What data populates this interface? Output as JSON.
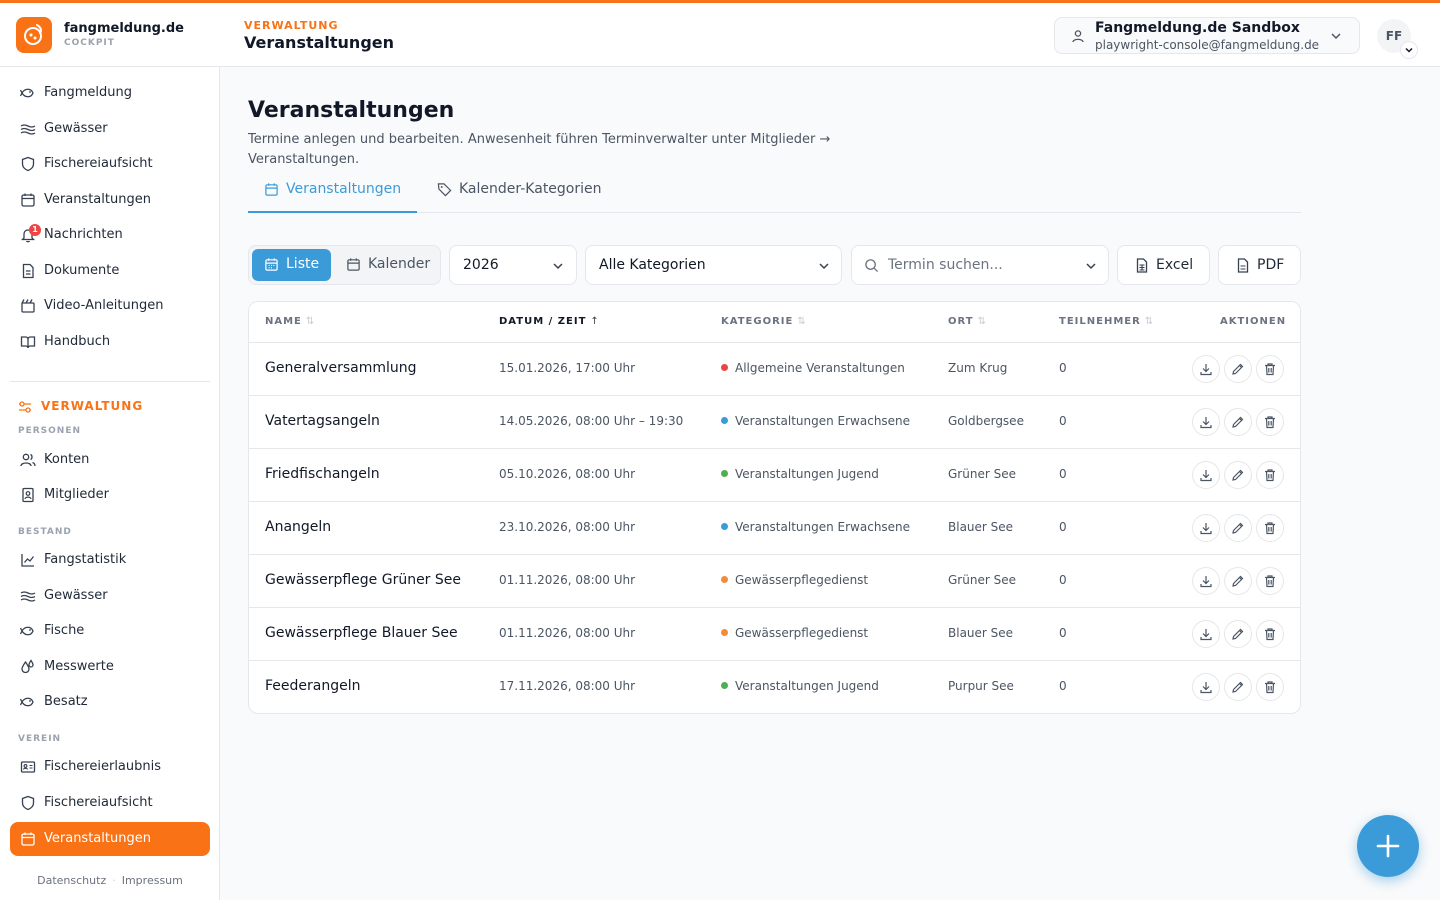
{
  "colors": {
    "accent": "#f97316",
    "primary": "#3b9bd9"
  },
  "header": {
    "brand": "fangmeldung.de",
    "brand_sub": "COCKPIT",
    "section_label": "VERWALTUNG",
    "title": "Veranstaltungen",
    "account_name": "Fangmeldung.de Sandbox",
    "account_email": "playwright-console@fangmeldung.de",
    "avatar_initials": "FF"
  },
  "sidebar": {
    "items": [
      {
        "label": "Fangmeldung",
        "icon": "fish-icon"
      },
      {
        "label": "Gewässer",
        "icon": "waves-icon"
      },
      {
        "label": "Fischereiaufsicht",
        "icon": "shield-icon"
      },
      {
        "label": "Veranstaltungen",
        "icon": "calendar-icon"
      },
      {
        "label": "Nachrichten",
        "icon": "bell-icon",
        "badge": "1"
      },
      {
        "label": "Dokumente",
        "icon": "document-icon"
      },
      {
        "label": "Video-Anleitungen",
        "icon": "video-icon"
      },
      {
        "label": "Handbuch",
        "icon": "book-icon"
      }
    ],
    "admin_title": "VERWALTUNG",
    "groups": {
      "personen": "PERSONEN",
      "bestand": "BESTAND",
      "verein": "VEREIN"
    },
    "admin_items": [
      {
        "label": "Konten",
        "icon": "users-icon"
      },
      {
        "label": "Mitglieder",
        "icon": "contact-card-icon"
      },
      {
        "label": "Fangstatistik",
        "icon": "line-chart-icon"
      },
      {
        "label": "Gewässer",
        "icon": "waves-icon"
      },
      {
        "label": "Fische",
        "icon": "fish-icon"
      },
      {
        "label": "Messwerte",
        "icon": "droplets-icon"
      },
      {
        "label": "Besatz",
        "icon": "fish-icon"
      },
      {
        "label": "Fischereierlaubnis",
        "icon": "id-card-icon"
      },
      {
        "label": "Fischereiaufsicht",
        "icon": "shield-icon"
      },
      {
        "label": "Veranstaltungen",
        "icon": "calendar-icon",
        "active": true
      }
    ],
    "footer": {
      "privacy": "Datenschutz",
      "separator": "·",
      "imprint": "Impressum"
    }
  },
  "main": {
    "title": "Veranstaltungen",
    "description": "Termine anlegen und bearbeiten. Anwesenheit führen Terminverwalter unter Mitglieder → Veranstaltungen.",
    "tabs": [
      {
        "label": "Veranstaltungen",
        "icon": "calendar-icon",
        "active": true
      },
      {
        "label": "Kalender-Kategorien",
        "icon": "tag-icon"
      }
    ],
    "toolbar": {
      "view_list": "Liste",
      "view_calendar": "Kalender",
      "year": "2026",
      "category": "Alle Kategorien",
      "search_placeholder": "Termin suchen...",
      "excel": "Excel",
      "pdf": "PDF"
    },
    "table": {
      "headers": {
        "name": "NAME",
        "date": "DATUM / ZEIT",
        "category": "KATEGORIE",
        "place": "ORT",
        "participants": "TEILNEHMER",
        "actions": "AKTIONEN"
      },
      "rows": [
        {
          "name": "Generalversammlung",
          "date": "15.01.2026, 17:00 Uhr",
          "category": "Allgemeine Veranstaltungen",
          "cat_color": "#ef4444",
          "place": "Zum Krug",
          "participants": "0"
        },
        {
          "name": "Vatertagsangeln",
          "date": "14.05.2026, 08:00 Uhr – 19:30",
          "category": "Veranstaltungen Erwachsene",
          "cat_color": "#3b9bd9",
          "place": "Goldbergsee",
          "participants": "0"
        },
        {
          "name": "Friedfischangeln",
          "date": "05.10.2026, 08:00 Uhr",
          "category": "Veranstaltungen Jugend",
          "cat_color": "#4caf50",
          "place": "Grüner See",
          "participants": "0"
        },
        {
          "name": "Anangeln",
          "date": "23.10.2026, 08:00 Uhr",
          "category": "Veranstaltungen Erwachsene",
          "cat_color": "#3b9bd9",
          "place": "Blauer See",
          "participants": "0"
        },
        {
          "name": "Gewässerpflege Grüner See",
          "date": "01.11.2026, 08:00 Uhr",
          "category": "Gewässerpflegedienst",
          "cat_color": "#f28c38",
          "place": "Grüner See",
          "participants": "0"
        },
        {
          "name": "Gewässerpflege Blauer See",
          "date": "01.11.2026, 08:00 Uhr",
          "category": "Gewässerpflegedienst",
          "cat_color": "#f28c38",
          "place": "Blauer See",
          "participants": "0"
        },
        {
          "name": "Feederangeln",
          "date": "17.11.2026, 08:00 Uhr",
          "category": "Veranstaltungen Jugend",
          "cat_color": "#4caf50",
          "place": "Purpur See",
          "participants": "0"
        }
      ]
    }
  }
}
